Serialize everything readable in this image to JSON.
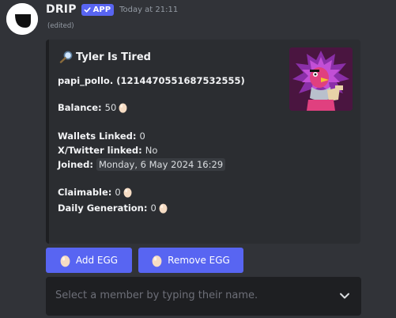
{
  "message": {
    "author": "DRIP",
    "badge": "APP",
    "timestamp": "Today at 21:11",
    "edited": "(edited)"
  },
  "embed": {
    "title": "Tyler Is Tired",
    "user_line": "papi_pollo. (1214470551687532555)",
    "balance_label": "Balance:",
    "balance_value": "50",
    "wallets_label": "Wallets Linked:",
    "wallets_value": "0",
    "twitter_label": "X/Twitter linked:",
    "twitter_value": "No",
    "joined_label": "Joined:",
    "joined_value": "Monday, 6 May 2024 16:29",
    "claimable_label": "Claimable:",
    "claimable_value": "0",
    "daily_label": "Daily Generation:",
    "daily_value": "0"
  },
  "buttons": {
    "add": "Add EGG",
    "remove": "Remove EGG"
  },
  "select": {
    "placeholder": "Select a member by typing their name."
  },
  "colors": {
    "background": "#313338",
    "embed": "#2b2d31",
    "blurple": "#5865f2",
    "select": "#1e1f22"
  },
  "icons": [
    "bot-avatar-icon",
    "checkmark-icon",
    "magnifier-icon",
    "egg-icon",
    "chevron-down-icon"
  ]
}
